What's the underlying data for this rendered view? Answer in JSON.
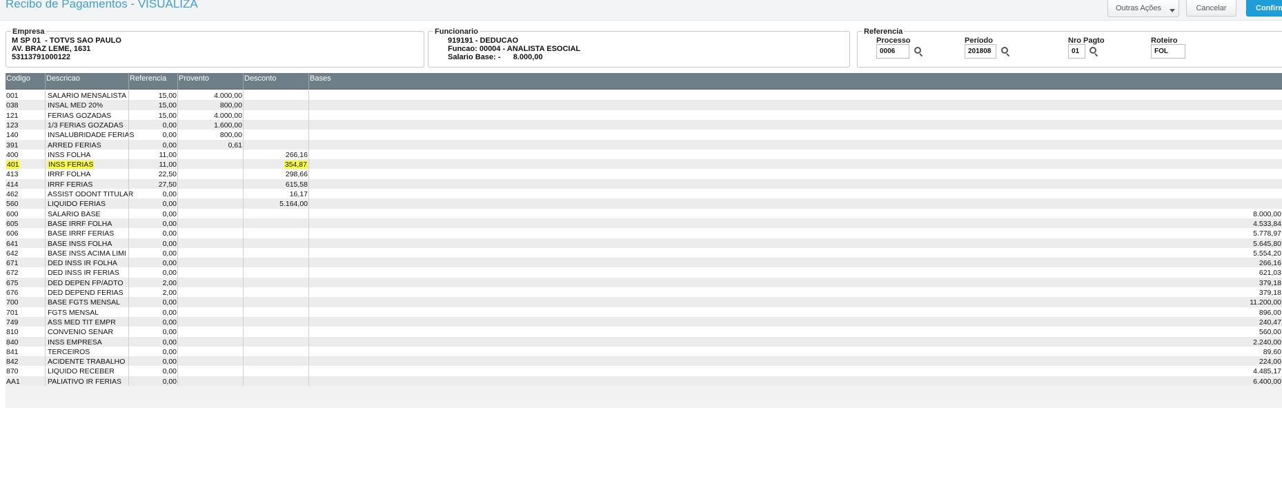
{
  "header": {
    "title": "Recibo de Pagamentos - VISUALIZA",
    "buttons": {
      "outras_acoes": "Outras Ações",
      "cancelar": "Cancelar",
      "confirmar": "Confirmar"
    }
  },
  "empresa": {
    "legend": "Empresa",
    "line1": "M SP 01  - TOTVS SAO PAULO",
    "line2": "AV. BRAZ LEME, 1631",
    "line3": "53113791000122"
  },
  "funcionario": {
    "legend": "Funcionario",
    "line1": "919191 - DEDUCAO",
    "line2": "Funcao: 00004 - ANALISTA ESOCIAL",
    "line3": "Salario Base: -      8.000,00"
  },
  "referencia": {
    "legend": "Referencia",
    "processo": {
      "label": "Processo",
      "value": "0006"
    },
    "periodo": {
      "label": "Período",
      "value": "201808"
    },
    "nro_pagto": {
      "label": "Nro Pagto",
      "value": "01"
    },
    "roteiro": {
      "label": "Roteiro",
      "value": "FOL"
    }
  },
  "grid": {
    "columns": [
      "Codigo",
      "Descricao",
      "Referencia",
      "Provento",
      "Desconto",
      "Bases"
    ],
    "rows": [
      {
        "codigo": "001",
        "descricao": "SALARIO  MENSALISTA",
        "referencia": "15,00",
        "provento": "4.000,00",
        "desconto": "",
        "bases": ""
      },
      {
        "codigo": "038",
        "descricao": "INSAL MED 20%",
        "referencia": "15,00",
        "provento": "800,00",
        "desconto": "",
        "bases": ""
      },
      {
        "codigo": "121",
        "descricao": "FERIAS GOZADAS",
        "referencia": "15,00",
        "provento": "4.000,00",
        "desconto": "",
        "bases": ""
      },
      {
        "codigo": "123",
        "descricao": "1/3 FERIAS GOZADAS",
        "referencia": "0,00",
        "provento": "1.600,00",
        "desconto": "",
        "bases": ""
      },
      {
        "codigo": "140",
        "descricao": "INSALUBRIDADE FERIAS",
        "referencia": "0,00",
        "provento": "800,00",
        "desconto": "",
        "bases": ""
      },
      {
        "codigo": "391",
        "descricao": "ARRED FERIAS",
        "referencia": "0,00",
        "provento": "0,61",
        "desconto": "",
        "bases": ""
      },
      {
        "codigo": "400",
        "descricao": "INSS FOLHA",
        "referencia": "11,00",
        "provento": "",
        "desconto": "266,16",
        "bases": ""
      },
      {
        "codigo": "401",
        "descricao": "INSS FERIAS",
        "referencia": "11,00",
        "provento": "",
        "desconto": "354,87",
        "bases": "",
        "highlight": true
      },
      {
        "codigo": "413",
        "descricao": "IRRF FOLHA",
        "referencia": "22,50",
        "provento": "",
        "desconto": "298,66",
        "bases": ""
      },
      {
        "codigo": "414",
        "descricao": "IRRF FERIAS",
        "referencia": "27,50",
        "provento": "",
        "desconto": "615,58",
        "bases": ""
      },
      {
        "codigo": "462",
        "descricao": "ASSIST ODONT TITULAR",
        "referencia": "0,00",
        "provento": "",
        "desconto": "16,17",
        "bases": ""
      },
      {
        "codigo": "560",
        "descricao": "LIQUIDO FERIAS",
        "referencia": "0,00",
        "provento": "",
        "desconto": "5.164,00",
        "bases": ""
      },
      {
        "codigo": "600",
        "descricao": "SALARIO BASE",
        "referencia": "0,00",
        "provento": "",
        "desconto": "",
        "bases": "8.000,00"
      },
      {
        "codigo": "605",
        "descricao": "BASE IRRF FOLHA",
        "referencia": "0,00",
        "provento": "",
        "desconto": "",
        "bases": "4.533,84"
      },
      {
        "codigo": "606",
        "descricao": "BASE IRRF FERIAS",
        "referencia": "0,00",
        "provento": "",
        "desconto": "",
        "bases": "5.778,97"
      },
      {
        "codigo": "641",
        "descricao": "BASE INSS FOLHA",
        "referencia": "0,00",
        "provento": "",
        "desconto": "",
        "bases": "5.645,80"
      },
      {
        "codigo": "642",
        "descricao": "BASE INSS ACIMA LIMI",
        "referencia": "0,00",
        "provento": "",
        "desconto": "",
        "bases": "5.554,20"
      },
      {
        "codigo": "671",
        "descricao": "DED INSS IR FOLHA",
        "referencia": "0,00",
        "provento": "",
        "desconto": "",
        "bases": "266,16"
      },
      {
        "codigo": "672",
        "descricao": "DED INSS IR FERIAS",
        "referencia": "0,00",
        "provento": "",
        "desconto": "",
        "bases": "621,03"
      },
      {
        "codigo": "675",
        "descricao": "DED DEPEN FP/ADTO",
        "referencia": "2,00",
        "provento": "",
        "desconto": "",
        "bases": "379,18"
      },
      {
        "codigo": "676",
        "descricao": "DED DEPEND FERIAS",
        "referencia": "2,00",
        "provento": "",
        "desconto": "",
        "bases": "379,18"
      },
      {
        "codigo": "700",
        "descricao": "BASE FGTS MENSAL",
        "referencia": "0,00",
        "provento": "",
        "desconto": "",
        "bases": "11.200,00"
      },
      {
        "codigo": "701",
        "descricao": "FGTS MENSAL",
        "referencia": "0,00",
        "provento": "",
        "desconto": "",
        "bases": "896,00"
      },
      {
        "codigo": "749",
        "descricao": "ASS MED TIT EMPR",
        "referencia": "0,00",
        "provento": "",
        "desconto": "",
        "bases": "240,47"
      },
      {
        "codigo": "810",
        "descricao": "CONVENIO SENAR",
        "referencia": "0,00",
        "provento": "",
        "desconto": "",
        "bases": "560,00"
      },
      {
        "codigo": "840",
        "descricao": "INSS EMPRESA",
        "referencia": "0,00",
        "provento": "",
        "desconto": "",
        "bases": "2.240,00"
      },
      {
        "codigo": "841",
        "descricao": "TERCEIROS",
        "referencia": "0,00",
        "provento": "",
        "desconto": "",
        "bases": "89,60"
      },
      {
        "codigo": "842",
        "descricao": "ACIDENTE TRABALHO",
        "referencia": "0,00",
        "provento": "",
        "desconto": "",
        "bases": "224,00"
      },
      {
        "codigo": "870",
        "descricao": "LIQUIDO RECEBER",
        "referencia": "0,00",
        "provento": "",
        "desconto": "",
        "bases": "4.485,17"
      },
      {
        "codigo": "AA1",
        "descricao": "PALIATIVO IR FERIAS",
        "referencia": "0,00",
        "provento": "",
        "desconto": "",
        "bases": "6.400,00"
      }
    ]
  },
  "colors": {
    "title": "#3f9fd1",
    "grid_header": "#6f7f87",
    "highlight": "#fbff38",
    "confirm_button": "#1e9ed9"
  },
  "icons": {
    "lookup": "search-icon",
    "dropdown": "chevron-down-icon"
  }
}
